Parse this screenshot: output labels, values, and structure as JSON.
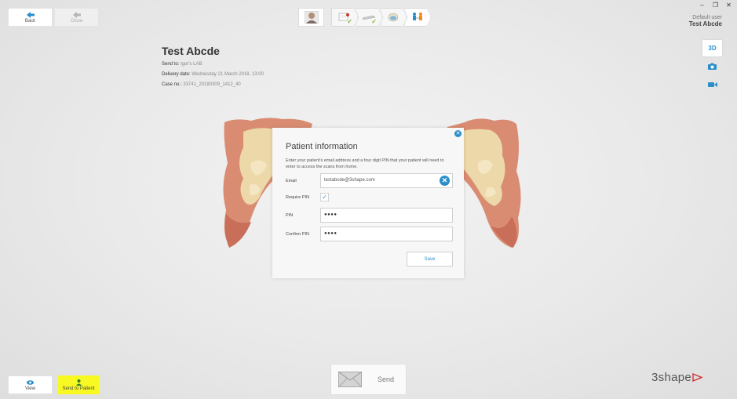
{
  "window": {
    "minimize": "–",
    "restore": "❐",
    "close": "✕"
  },
  "nav": {
    "back_label": "Back",
    "close_label": "Close"
  },
  "user": {
    "role_label": "Default user",
    "name": "Test Abcde"
  },
  "sidetools": {
    "view3d": "3D"
  },
  "case": {
    "patient_name": "Test Abcde",
    "send_to_label": "Send to:",
    "send_to_value": "Igor's LAB",
    "delivery_label": "Delivery date:",
    "delivery_value": "Wednesday 21 March 2018, 13:00",
    "case_no_label": "Case no.:",
    "case_no_value": "33741_20180309_1412_40"
  },
  "dialog": {
    "title": "Patient information",
    "description": "Enter your patient's email address and a four digit PIN that your patient will need to enter to access the scans from home.",
    "email_label": "Email",
    "email_value": "testabcde@3shape.com",
    "require_pin_label": "Require PIN",
    "require_pin_checked": true,
    "pin_label": "PIN",
    "pin_value": "●●●●",
    "confirm_pin_label": "Confirm PIN",
    "confirm_pin_value": "●●●●",
    "save_label": "Save"
  },
  "bottom": {
    "view_label": "View",
    "send_to_patient_label": "Send to Patient",
    "send_label": "Send"
  },
  "logo": {
    "text": "3shape"
  },
  "colors": {
    "accent": "#2a8fc9",
    "highlight": "#f8f822",
    "check": "#7ab828"
  }
}
